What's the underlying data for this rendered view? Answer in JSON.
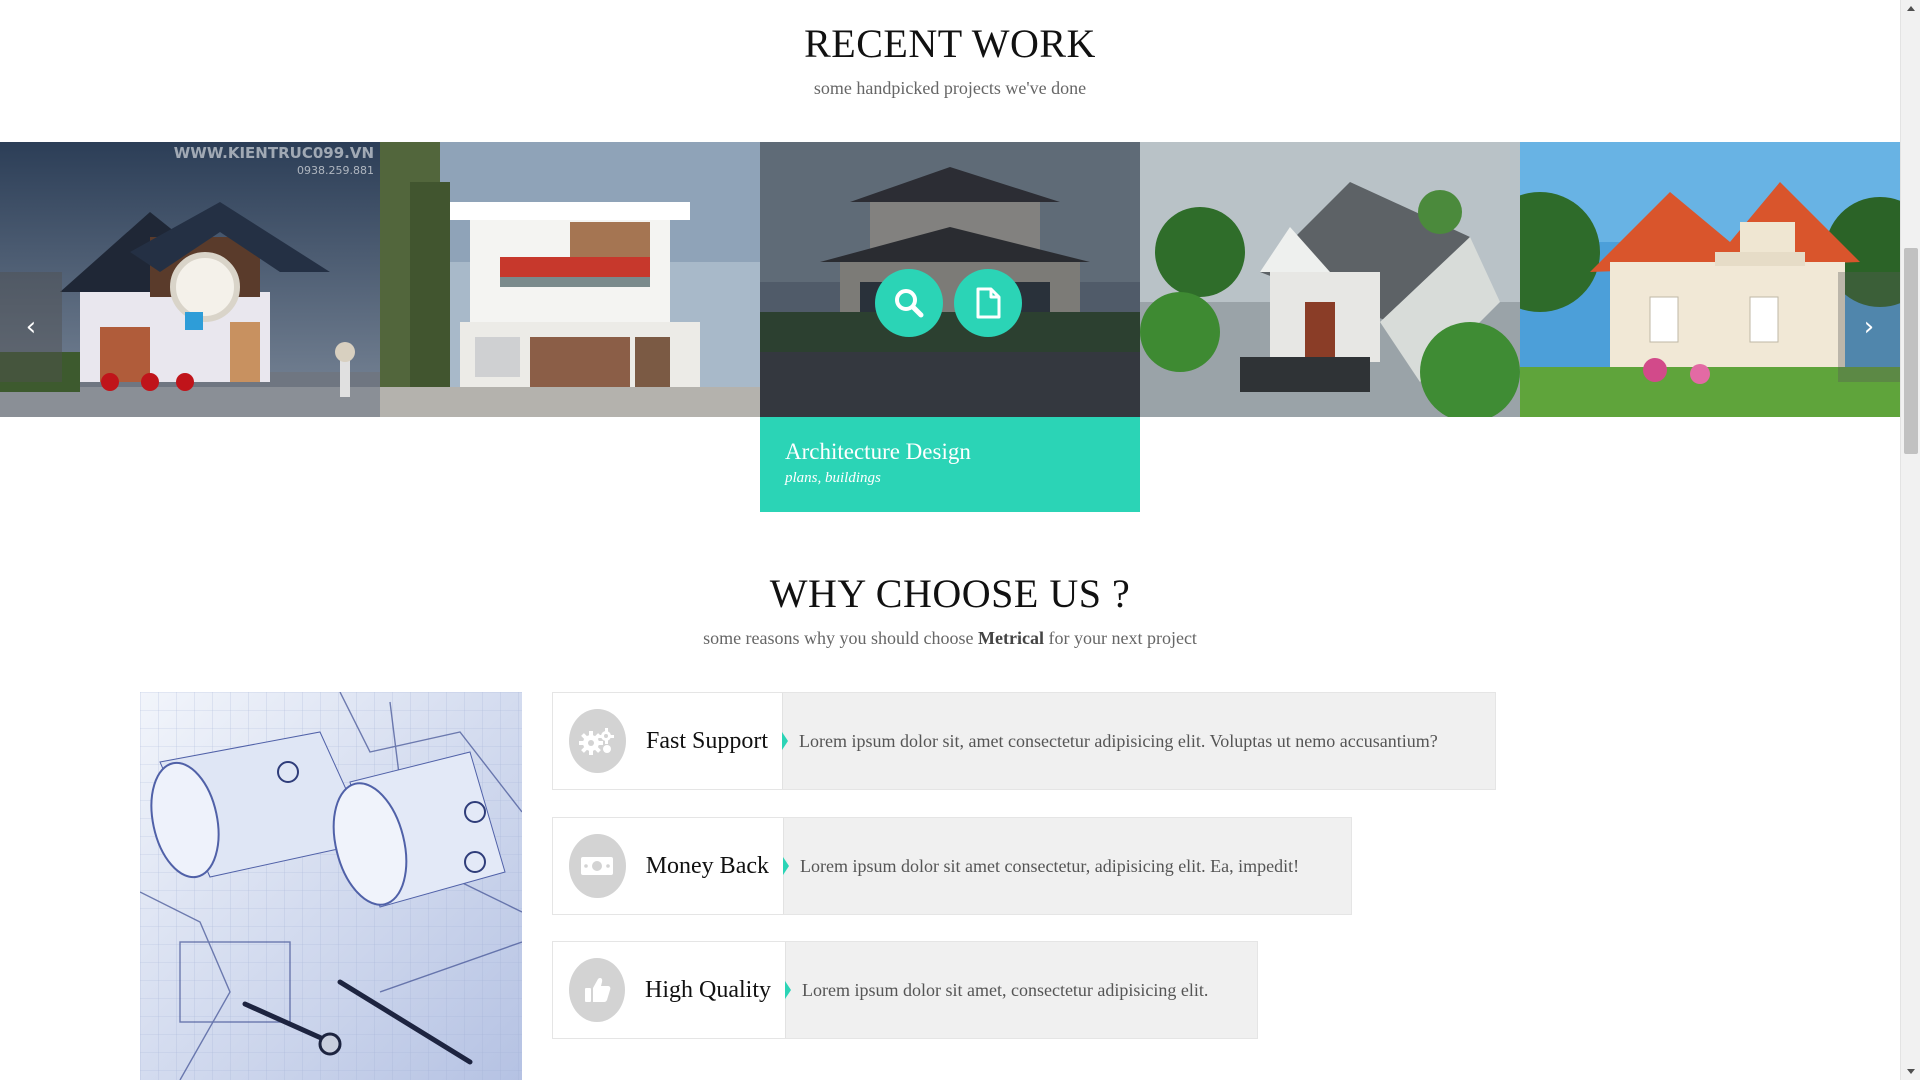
{
  "recent_work": {
    "title": "RECENT WORK",
    "subtitle": "some handpicked projects we've done"
  },
  "gallery": {
    "watermark_site": "WWW.KIENTRUC099.VN",
    "watermark_phone": "0938.259.881",
    "prev_icon": "chevron-left-icon",
    "next_icon": "chevron-right-icon",
    "active_caption": {
      "title": "Architecture Design",
      "tags": "plans, buildings"
    },
    "accent_color": "#2bd4b6"
  },
  "why_choose": {
    "title": "WHY CHOOSE US ?",
    "subtitle_before": "some reasons why you should choose ",
    "subtitle_brand": "Metrical",
    "subtitle_after": " for your next project",
    "features": [
      {
        "title": "Fast Support",
        "icon": "gears-icon",
        "text": "Lorem ipsum dolor sit, amet consectetur adipisicing elit. Voluptas ut nemo accusantium?"
      },
      {
        "title": "Money Back",
        "icon": "money-icon",
        "text": "Lorem ipsum dolor sit amet consectetur, adipisicing elit. Ea, impedit!"
      },
      {
        "title": "High Quality",
        "icon": "thumbs-up-icon",
        "text": "Lorem ipsum dolor sit amet, consectetur adipisicing elit."
      }
    ]
  }
}
